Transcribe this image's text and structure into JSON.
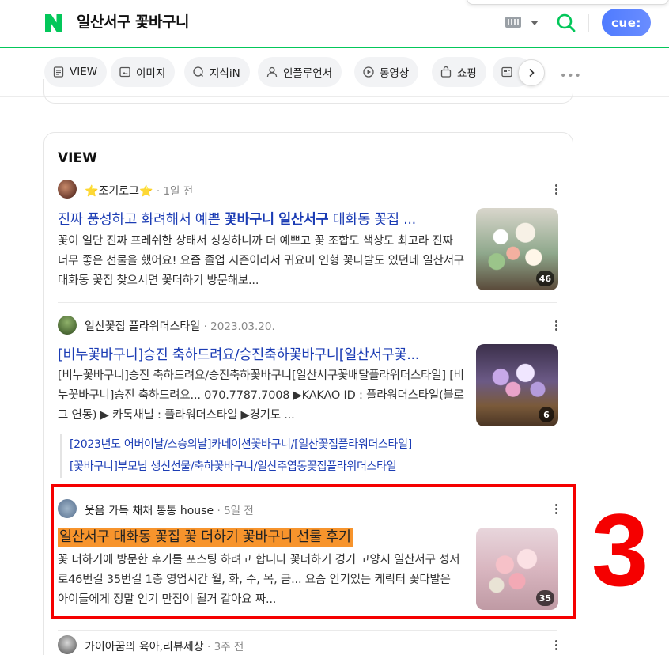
{
  "header": {
    "query": "일산서구 꽃바구니",
    "assistant_label": "cue:"
  },
  "tabs": [
    {
      "label": "VIEW",
      "icon": "doc-icon"
    },
    {
      "label": "이미지",
      "icon": "image-icon"
    },
    {
      "label": "지식iN",
      "icon": "qna-icon"
    },
    {
      "label": "인플루언서",
      "icon": "person-icon"
    },
    {
      "label": "동영상",
      "icon": "play-icon"
    },
    {
      "label": "쇼핑",
      "icon": "bag-icon"
    }
  ],
  "section": {
    "title": "VIEW"
  },
  "posts": [
    {
      "author_prefix": "⭐",
      "author": "조기로그",
      "author_suffix": "⭐",
      "date": "· 1일 전",
      "title_parts": [
        "진짜 풍성하고 화려해서 예쁜 ",
        "꽃바구니",
        " ",
        "일산서구",
        " 대화동 꽃집 ..."
      ],
      "desc": "꽃이 일단 진짜 프레쉬한 상태서 싱싱하니까 더 예쁘고 꽃 조합도 색상도 최고라 진짜 너무 좋은 선물을 했어요! 요즘 졸업 시즌이라서 귀요미 인형 꽃다발도 있던데 일산서구 대화동 꽃집 찾으시면 꽃더하기 방문해보...",
      "image_count": "46"
    },
    {
      "author": "일산꽃집 플라워더스타일",
      "date": "· 2023.03.20.",
      "title": "[비누꽃바구니]승진 축하드려요/승진축하꽃바구니[일산서구꽃...",
      "desc": "[비누꽃바구니]승진 축하드려요/승진축하꽃바구니[일산서구꽃배달플라워더스타일] [비누꽃바구니]승진 축하드려요... 070.7787.7008 ▶KAKAO ID : 플라워더스타일(블로그 연동) ▶ 카톡채널 : 플라워더스타일 ▶경기도 ...",
      "image_count": "6",
      "sublinks": [
        "[2023년도 어버이날/스승의날]카네이션꽃바구니/[일산꽃집플라워더스타일]",
        "[꽃바구니]부모님 생신선물/축하꽃바구니/일산주엽동꽃집플라워더스타일"
      ]
    },
    {
      "author": "웃음 가득 채채 통통 house",
      "date": "· 5일 전",
      "title": "일산서구 대화동 꽃집 꽃 더하기 꽃바구니 선물 후기",
      "desc": "꽃 더하기에 방문한 후기를 포스팅 하려고 합니다 꽃더하기 경기 고양시 일산서구 성저로46번길 35번길 1층 영업시간 월, 화, 수, 목, 금... 요즘 인기있는 케릭터 꽃다발은 아이들에게 정말 인기 만점이 될거 같아요 짜...",
      "image_count": "35"
    },
    {
      "author": "가이아꿈의 육아,리뷰세상",
      "date": "· 3주 전"
    }
  ],
  "annotation": {
    "label": "3",
    "color": "#f50000"
  },
  "colors": {
    "brand": "#03c75a",
    "link": "#1b3cb4",
    "highlight": "#f7942c"
  }
}
